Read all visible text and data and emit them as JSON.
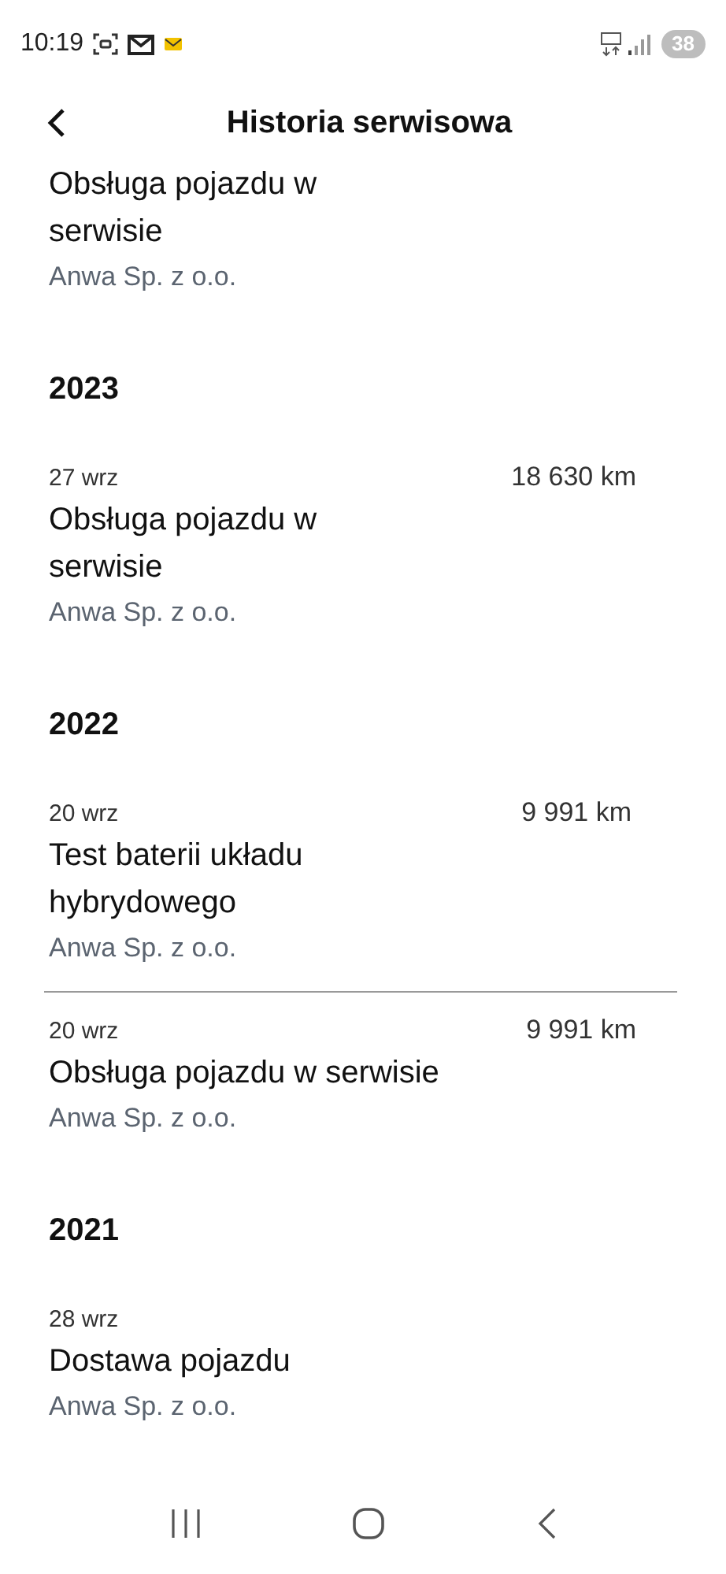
{
  "status_bar": {
    "time": "10:19",
    "battery": "38"
  },
  "header": {
    "title": "Historia serwisowa"
  },
  "items": [
    {
      "kind": "entry",
      "title": "Obsługa pojazdu w\nserwisie",
      "company": "Anwa Sp. z o.o.",
      "divider": false
    },
    {
      "kind": "year",
      "label": "2023"
    },
    {
      "kind": "entry",
      "date": "27 wrz",
      "km": "18 630 km",
      "title": "Obsługa pojazdu w\nserwisie",
      "company": "Anwa Sp. z o.o.",
      "divider": false
    },
    {
      "kind": "year",
      "label": "2022"
    },
    {
      "kind": "entry",
      "date": "20 wrz",
      "km": "9 991 km",
      "title": "Test baterii układu\nhybrydowego",
      "company": "Anwa Sp. z o.o.",
      "divider": true
    },
    {
      "kind": "entry",
      "date": "20 wrz",
      "km": "9 991 km",
      "title": "Obsługa pojazdu w serwisie",
      "company": "Anwa Sp. z o.o.",
      "divider": false
    },
    {
      "kind": "year",
      "label": "2021"
    },
    {
      "kind": "entry",
      "date": "28 wrz",
      "title": "Dostawa pojazdu",
      "company": "Anwa Sp. z o.o.",
      "divider": false
    }
  ]
}
